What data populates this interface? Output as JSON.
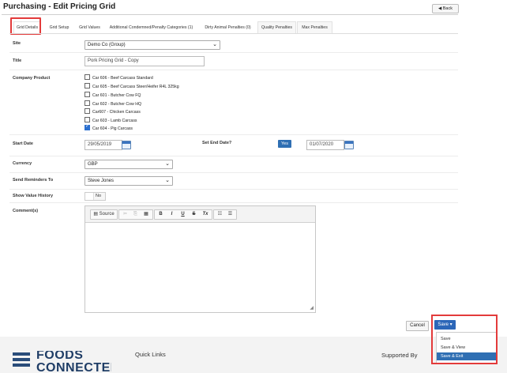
{
  "header": {
    "title": "Purchasing - Edit Pricing Grid",
    "back_label": "Back"
  },
  "tabs": [
    {
      "label": "Grid Details",
      "active": true
    },
    {
      "label": "Grid Setup"
    },
    {
      "label": "Grid Values"
    },
    {
      "label": "Additional Condemned/Penalty Categories (1)"
    },
    {
      "label": "Dirty Animal Penalties (0)"
    },
    {
      "label": "Quality Penalties"
    },
    {
      "label": "Max Penalties"
    }
  ],
  "form": {
    "site": {
      "label": "Site",
      "value": "Demo Co (Group)"
    },
    "title": {
      "label": "Title",
      "value": "Pork Pricing Grid - Copy"
    },
    "company_product": {
      "label": "Company Product",
      "items": [
        {
          "label": "Car 606 - Beef Carcass Standard",
          "checked": false
        },
        {
          "label": "Car 605 - Beef Carcass Steer/Heifer R4L 325kg",
          "checked": false
        },
        {
          "label": "Car 601 - Butcher Cow FQ",
          "checked": false
        },
        {
          "label": "Car 602 - Butcher Cow HQ",
          "checked": false
        },
        {
          "label": "Car607 - Chicken Carcass",
          "checked": false
        },
        {
          "label": "Car 603 - Lamb Carcass",
          "checked": false
        },
        {
          "label": "Car 604 - Pig Carcass",
          "checked": true
        }
      ]
    },
    "start_date": {
      "label": "Start Date",
      "value": "29/05/2019"
    },
    "end_date": {
      "label": "Set End Date?",
      "toggle": "Yes",
      "value": "01/07/2020"
    },
    "currency": {
      "label": "Currency",
      "value": "GBP"
    },
    "send_reminders": {
      "label": "Send Reminders To",
      "value": "Steve Jones"
    },
    "show_value_history": {
      "label": "Show Value History",
      "toggle": "No"
    },
    "comments": {
      "label": "Comment(s)",
      "toolbar": {
        "source": "Source",
        "bold": "B",
        "italic": "I",
        "underline": "U",
        "strike": "S",
        "clear": "Tx"
      }
    }
  },
  "actions": {
    "cancel": "Cancel",
    "save": "Save",
    "save_menu": [
      {
        "label": "Save"
      },
      {
        "label": "Save & View"
      },
      {
        "label": "Save & Exit",
        "selected": true
      }
    ]
  },
  "footer": {
    "logo_line1": "FOODS",
    "logo_line2": "CONNECTED",
    "quick_links": "Quick Links",
    "supported_by": "Supported By"
  },
  "colors": {
    "accent": "#2c66b8",
    "highlight": "#e33b3b"
  }
}
